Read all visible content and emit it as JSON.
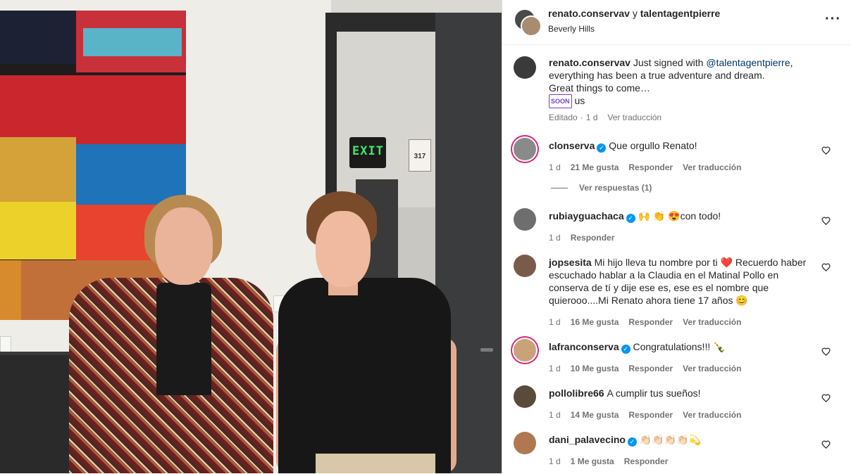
{
  "post": {
    "authors_bold_1": "renato.conservav",
    "authors_sep": " y ",
    "authors_bold_2": "talentagentpierre",
    "location": "Beverly Hills",
    "more_icon": "more-horizontal-icon"
  },
  "photo": {
    "exit_text": "EXIT",
    "plaque_number": "317"
  },
  "caption": {
    "username": "renato.conservav",
    "text_1": " Just signed with ",
    "mention": "@talentagentpierre",
    "text_2": ",",
    "line_2": "everything has been a true adventure and dream.",
    "line_3": "Great things to come…",
    "soon_badge": "SOON",
    "line_4": "us",
    "edited": "Editado",
    "sep": "·",
    "time": "1 d",
    "translate": "Ver traducción"
  },
  "comments": [
    {
      "username": "clonserva",
      "verified": true,
      "text": "Que orgullo Renato!",
      "time": "1 d",
      "likes": "21 Me gusta",
      "reply": "Responder",
      "translate": "Ver traducción",
      "avatar_color": "#8a8a8a",
      "ring": true
    },
    {
      "username": "rubiayguachaca",
      "verified": true,
      "text": "🙌 👏 😍con todo!",
      "time": "1 d",
      "likes": "",
      "reply": "Responder",
      "translate": "",
      "avatar_color": "#6e6e6e",
      "ring": false
    },
    {
      "username": "jopsesita",
      "verified": false,
      "text": "Mi hijo lleva tu nombre por ti ❤️ Recuerdo haber escuchado hablar a la Claudia en el Matinal Pollo en conserva de tí y dije ese es, ese es el nombre que quierooo....Mi Renato ahora tiene 17 años 😊",
      "time": "1 d",
      "likes": "16 Me gusta",
      "reply": "Responder",
      "translate": "Ver traducción",
      "avatar_color": "#7a5a4a",
      "ring": false
    },
    {
      "username": "lafranconserva",
      "verified": true,
      "text": "Congratulations!!! 🍾",
      "time": "1 d",
      "likes": "10 Me gusta",
      "reply": "Responder",
      "translate": "Ver traducción",
      "avatar_color": "#c9a27a",
      "ring": true
    },
    {
      "username": "pollolibre66",
      "verified": false,
      "text": "A cumplir tus sueños!",
      "time": "1 d",
      "likes": "14 Me gusta",
      "reply": "Responder",
      "translate": "Ver traducción",
      "avatar_color": "#5a4a3a",
      "ring": false
    },
    {
      "username": "dani_palavecino",
      "verified": true,
      "text": "👏🏻👏🏻👏🏻👏🏻💫",
      "time": "1 d",
      "likes": "1 Me gusta",
      "reply": "Responder",
      "translate": "",
      "avatar_color": "#b07850",
      "ring": false
    }
  ],
  "view_replies": "Ver respuestas (1)",
  "colors": {
    "verified": "#0095f6",
    "meta_gray": "#737373",
    "mention": "#00376b",
    "story_ring": "#d62976"
  }
}
